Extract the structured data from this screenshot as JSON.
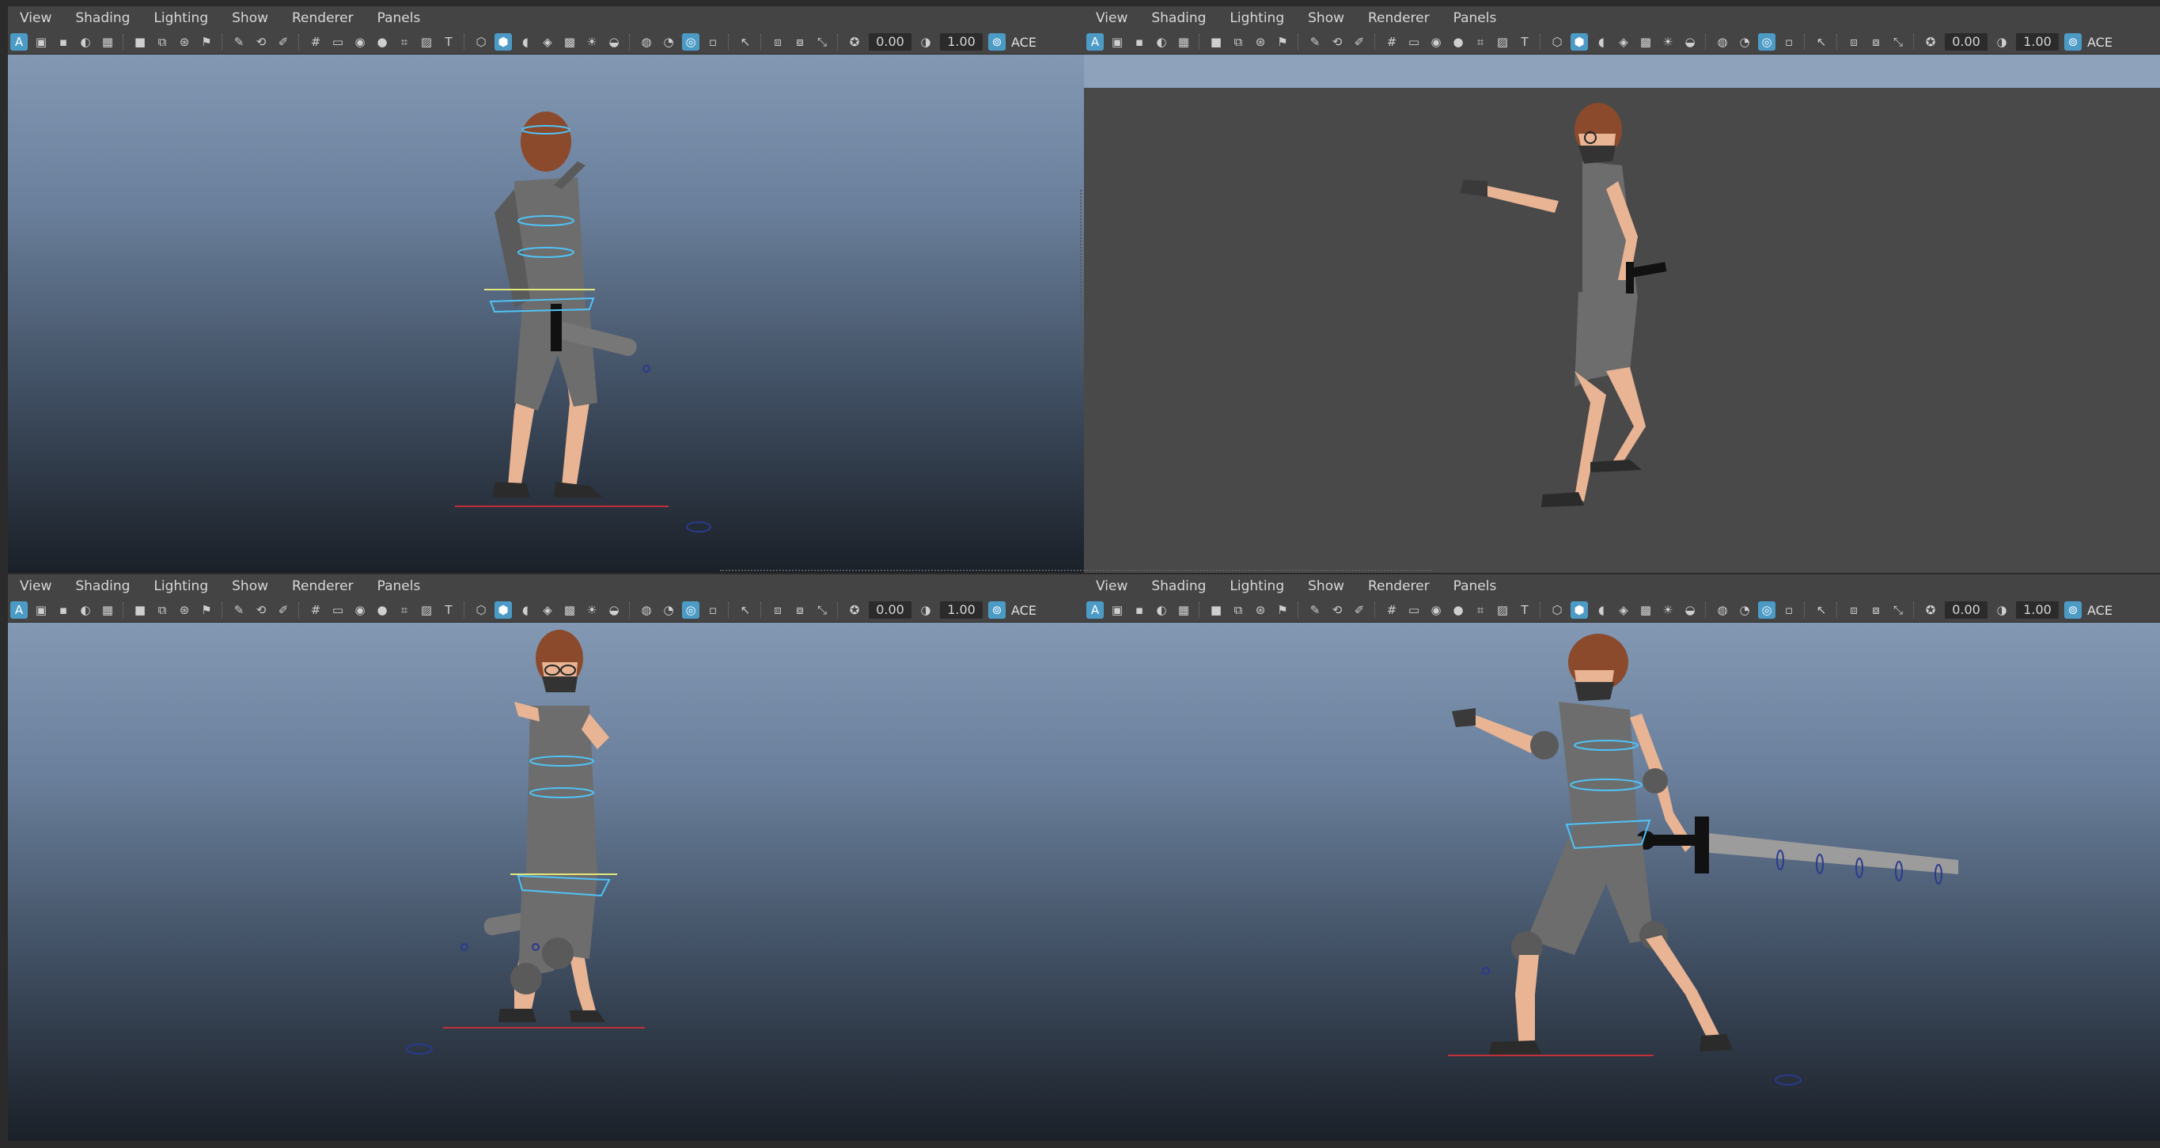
{
  "menus": [
    "View",
    "Shading",
    "Lighting",
    "Show",
    "Renderer",
    "Panels"
  ],
  "toolbar": {
    "exposure_value": "0.00",
    "gamma_value": "1.00",
    "color_space_label": "ACE"
  },
  "viewports": [
    {
      "id": "top-left",
      "shading": "gradient",
      "character": "rigged-back-view"
    },
    {
      "id": "top-right",
      "shading": "flat-gray",
      "character": "unrigged-side-view"
    },
    {
      "id": "bottom-left",
      "shading": "gradient",
      "character": "rigged-front-view"
    },
    {
      "id": "bottom-right",
      "shading": "gradient",
      "character": "rigged-perspective-sword"
    }
  ],
  "colors": {
    "accent": "#4c9bc6",
    "ground_line": "#c0303a",
    "rig_controls": "#4fc3f7",
    "hair": "#8b4a2b",
    "skin": "#e8b493",
    "suit": "#6d6d6d"
  }
}
